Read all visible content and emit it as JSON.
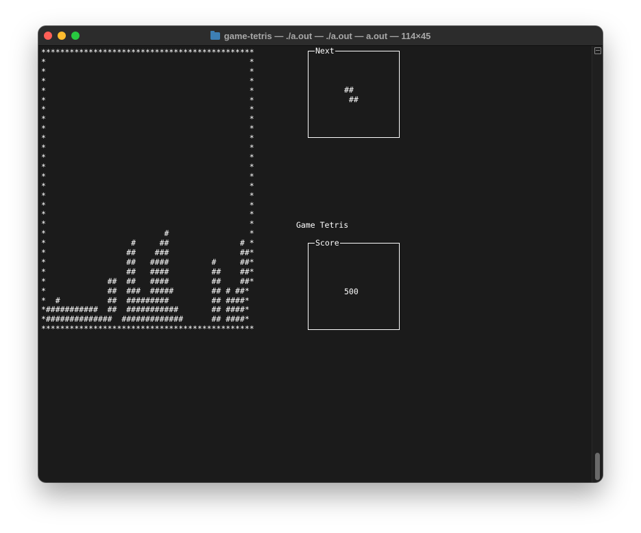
{
  "window": {
    "title": "game-tetris — ./a.out — ./a.out — a.out — 114×45",
    "colors": {
      "close": "#ff5f57",
      "minimize": "#febc2e",
      "zoom": "#28c840",
      "folder": "#3d7fb5",
      "background": "#1b1b1b",
      "text": "#ffffff"
    }
  },
  "terminal": {
    "board_lines": [
      "*********************************************",
      "*                                           *",
      "*                                           *",
      "*                                           *",
      "*                                           *",
      "*                                           *",
      "*                                           *",
      "*                                           *",
      "*                                           *",
      "*                                           *",
      "*                                           *",
      "*                                           *",
      "*                                           *",
      "*                                           *",
      "*                                           *",
      "*                                           *",
      "*                                           *",
      "*                                           *",
      "*                                           *",
      "*                         #                 *",
      "*                  #     ##               # *",
      "*                 ##    ###               ##*",
      "*                 ##   ####         #     ##*",
      "*                 ##   ####         ##    ##*",
      "*             ##  ##   ####         ##    ##*",
      "*             ##  ###  #####        ## # ##*",
      "*  #          ##  #########         ## ####*",
      "*###########  ##  ###########       ## ####*",
      "*##############  #############      ## ####*",
      "*********************************************"
    ],
    "next_label": "Next",
    "next_piece": "##\n ##",
    "game_title": "Game Tetris",
    "score_label": "Score",
    "score_value": "500"
  }
}
